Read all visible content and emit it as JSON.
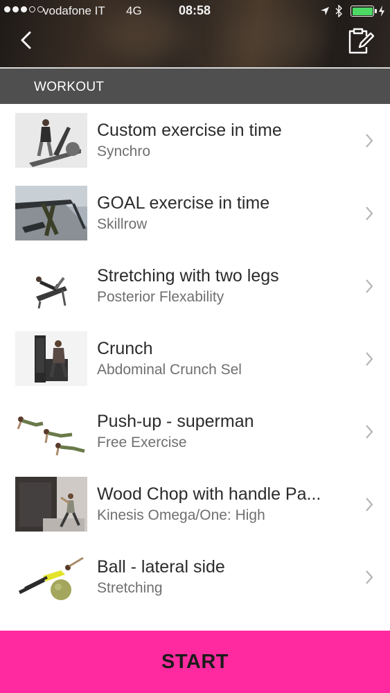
{
  "status_bar": {
    "carrier": "vodafone IT",
    "network": "4G",
    "time": "08:58",
    "battery_level": 1.0,
    "battery_color": "#4cd964",
    "icons": [
      "signal-dots-icon",
      "location-arrow-icon",
      "bluetooth-icon",
      "battery-icon",
      "charging-icon"
    ]
  },
  "nav": {
    "back_icon": "chevron-left-icon",
    "clipboard_icon": "clipboard-edit-icon"
  },
  "section": {
    "title": "WORKOUT"
  },
  "exercises": [
    {
      "title": "Custom exercise in time",
      "subtitle": "Synchro",
      "thumb": "elliptical-trainer-photo"
    },
    {
      "title": "GOAL exercise in time",
      "subtitle": "Skillrow",
      "thumb": "rowing-machine-photo"
    },
    {
      "title": "Stretching with two legs",
      "subtitle": "Posterior Flexability",
      "thumb": "stretching-machine-photo"
    },
    {
      "title": "Crunch",
      "subtitle": "Abdominal Crunch Sel",
      "thumb": "crunch-machine-photo"
    },
    {
      "title": "Push-up - superman",
      "subtitle": "Free Exercise",
      "thumb": "push-up-sequence-photo"
    },
    {
      "title": "Wood Chop with handle Pa...",
      "subtitle": "Kinesis Omega/One: High",
      "thumb": "kinesis-station-photo"
    },
    {
      "title": "Ball - lateral side",
      "subtitle": "Stretching",
      "thumb": "ball-stretch-photo"
    }
  ],
  "start_button": {
    "label": "START",
    "color": "#ff2aa0"
  },
  "colors": {
    "section_bg": "#4f4f4f",
    "title_text": "#2b2b2b",
    "subtitle_text": "#6f6f6f"
  }
}
